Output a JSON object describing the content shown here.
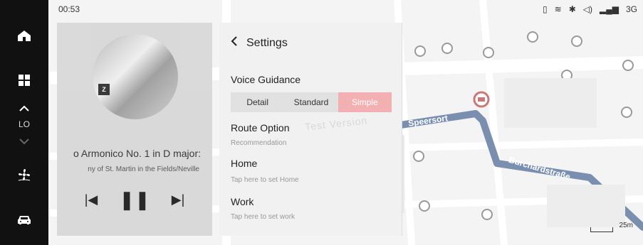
{
  "status": {
    "time": "00:53",
    "network": "3G"
  },
  "left_nav": {
    "items": [
      {
        "name": "home",
        "icon": "home-icon"
      },
      {
        "name": "apps",
        "icon": "grid-icon"
      },
      {
        "name": "temperature",
        "label": "LO",
        "icon": "chevron-icon"
      },
      {
        "name": "climate",
        "icon": "fan-icon"
      },
      {
        "name": "vehicle",
        "icon": "car-icon"
      }
    ]
  },
  "media": {
    "track_title": "o Armonico No. 1 in D major:",
    "artist": "ny of St. Martin in the Fields/Neville",
    "album_mark": "Z",
    "controls": {
      "prev": "previous",
      "play_pause": "pause",
      "next": "next"
    }
  },
  "settings": {
    "title": "Settings",
    "voice_guidance": {
      "label": "Voice Guidance",
      "options": [
        "Detail",
        "Standard",
        "Simple"
      ],
      "selected": "Simple"
    },
    "route_option": {
      "label": "Route Option",
      "value": "Recommendation"
    },
    "home": {
      "label": "Home",
      "placeholder": "Tap here to set Home"
    },
    "work": {
      "label": "Work",
      "placeholder": "Tap here to set work"
    },
    "watermark": "Test Version"
  },
  "map": {
    "streets": [
      {
        "name": "Speersort"
      },
      {
        "name": "Burchardstraße"
      }
    ],
    "scale_label": "25m"
  },
  "colors": {
    "accent_pink": "#f3b0b3",
    "nav_bg": "#111111",
    "route": "#7a8fb0"
  }
}
